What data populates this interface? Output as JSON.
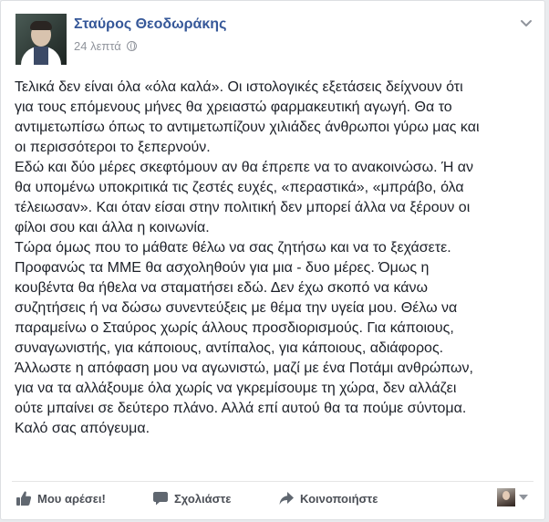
{
  "post": {
    "author": "Σταύρος Θεοδωράκης",
    "time": "24 λεπτά",
    "privacy_icon": "globe-icon",
    "menu_icon": "chevron-down-icon",
    "lines": [
      "Τελικά δεν είναι όλα «όλα καλά». Οι ιστολογικές εξετάσεις δείχνουν ότι",
      "για τους επόμενους μήνες θα χρειαστώ φαρμακευτική αγωγή. Θα το",
      "αντιμετωπίσω όπως το αντιμετωπίζουν χιλιάδες άνθρωποι γύρω μας και",
      "οι περισσότεροι το ξεπερνούν.",
      "Εδώ και δύο μέρες σκεφτόμουν αν θα έπρεπε να το ανακοινώσω. Ή αν",
      "θα υπομένω υποκριτικά τις ζεστές ευχές, «περαστικά», «μπράβο, όλα",
      "τέλειωσαν». Και όταν είσαι στην πολιτική δεν μπορεί άλλα να ξέρουν οι",
      "φίλοι σου και άλλα η κοινωνία.",
      "Τώρα όμως που το μάθατε θέλω να σας ζητήσω και να το ξεχάσετε.",
      "Προφανώς τα ΜΜΕ θα ασχοληθούν για μια - δυο μέρες. Όμως η",
      "κουβέντα θα ήθελα να σταματήσει εδώ. Δεν έχω σκοπό να κάνω",
      "συζητήσεις ή να δώσω συνεντεύξεις με θέμα την υγεία μου. Θέλω να",
      "παραμείνω ο Σταύρος χωρίς άλλους προσδιορισμούς. Για κάποιους,",
      "συναγωνιστής, για κάποιους, αντίπαλος, για κάποιους, αδιάφορος.",
      "Άλλωστε η απόφαση μου να αγωνιστώ, μαζί με ένα Ποτάμι ανθρώπων,",
      "για να τα αλλάξουμε όλα χωρίς να γκρεμίσουμε τη χώρα, δεν αλλάζει",
      "ούτε μπαίνει σε δεύτερο πλάνο. Αλλά επί αυτού θα τα πούμε σύντομα.",
      "Καλό σας απόγευμα."
    ]
  },
  "actions": {
    "like_label": "Μου αρέσει!",
    "comment_label": "Σχολιάστε",
    "share_label": "Κοινοποιήστε",
    "like_icon": "thumbs-up-icon",
    "comment_icon": "comment-icon",
    "share_icon": "share-arrow-icon"
  },
  "colors": {
    "author_link": "#365899",
    "meta_text": "#90949c",
    "body_text": "#1d2129",
    "action_text": "#4b4f56"
  }
}
